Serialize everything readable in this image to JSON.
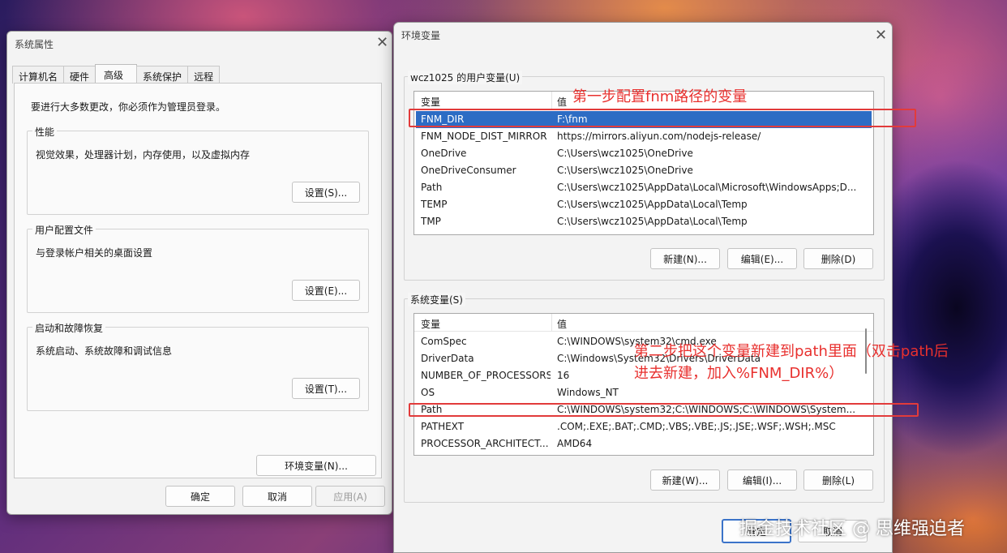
{
  "system_properties": {
    "title": "系统属性",
    "tabs": [
      "计算机名",
      "硬件",
      "高级",
      "系统保护",
      "远程"
    ],
    "active_tab": "高级",
    "admin_note": "要进行大多数更改，你必须作为管理员登录。",
    "performance": {
      "label": "性能",
      "desc": "视觉效果，处理器计划，内存使用，以及虚拟内存",
      "button": "设置(S)..."
    },
    "user_profiles": {
      "label": "用户配置文件",
      "desc": "与登录帐户相关的桌面设置",
      "button": "设置(E)..."
    },
    "startup_recovery": {
      "label": "启动和故障恢复",
      "desc": "系统启动、系统故障和调试信息",
      "button": "设置(T)..."
    },
    "env_button": "环境变量(N)...",
    "ok": "确定",
    "cancel": "取消",
    "apply": "应用(A)"
  },
  "env_dialog": {
    "title": "环境变量",
    "user_group_label": "wcz1025 的用户变量(U)",
    "columns": {
      "name": "变量",
      "value": "值"
    },
    "user_vars": [
      {
        "name": "FNM_DIR",
        "value": "F:\\fnm"
      },
      {
        "name": "FNM_NODE_DIST_MIRROR",
        "value": "https://mirrors.aliyun.com/nodejs-release/"
      },
      {
        "name": "OneDrive",
        "value": "C:\\Users\\wcz1025\\OneDrive"
      },
      {
        "name": "OneDriveConsumer",
        "value": "C:\\Users\\wcz1025\\OneDrive"
      },
      {
        "name": "Path",
        "value": "C:\\Users\\wcz1025\\AppData\\Local\\Microsoft\\WindowsApps;D..."
      },
      {
        "name": "TEMP",
        "value": "C:\\Users\\wcz1025\\AppData\\Local\\Temp"
      },
      {
        "name": "TMP",
        "value": "C:\\Users\\wcz1025\\AppData\\Local\\Temp"
      }
    ],
    "selected_user_var": "FNM_DIR",
    "user_buttons": {
      "new": "新建(N)...",
      "edit": "编辑(E)...",
      "delete": "删除(D)"
    },
    "system_group_label": "系统变量(S)",
    "system_vars": [
      {
        "name": "ComSpec",
        "value": "C:\\WINDOWS\\system32\\cmd.exe"
      },
      {
        "name": "DriverData",
        "value": "C:\\Windows\\System32\\Drivers\\DriverData"
      },
      {
        "name": "NUMBER_OF_PROCESSORS",
        "value": "16"
      },
      {
        "name": "OS",
        "value": "Windows_NT"
      },
      {
        "name": "Path",
        "value": "C:\\WINDOWS\\system32;C:\\WINDOWS;C:\\WINDOWS\\System..."
      },
      {
        "name": "PATHEXT",
        "value": ".COM;.EXE;.BAT;.CMD;.VBS;.VBE;.JS;.JSE;.WSF;.WSH;.MSC"
      },
      {
        "name": "PROCESSOR_ARCHITECT...",
        "value": "AMD64"
      }
    ],
    "system_buttons": {
      "new": "新建(W)...",
      "edit": "编辑(I)...",
      "delete": "删除(L)"
    },
    "ok": "确定",
    "cancel": "取消"
  },
  "annotations": {
    "step1": "第一步配置fnm路径的变量",
    "step2_line1": "第二步把这个变量新建到path里面（双击path后",
    "step2_line2": "进去新建，加入%FNM_DIR%）",
    "color": "#e8302e"
  },
  "watermark": "掘金技术社区 @ 思维强迫者",
  "icons": {
    "close": "close-icon"
  }
}
